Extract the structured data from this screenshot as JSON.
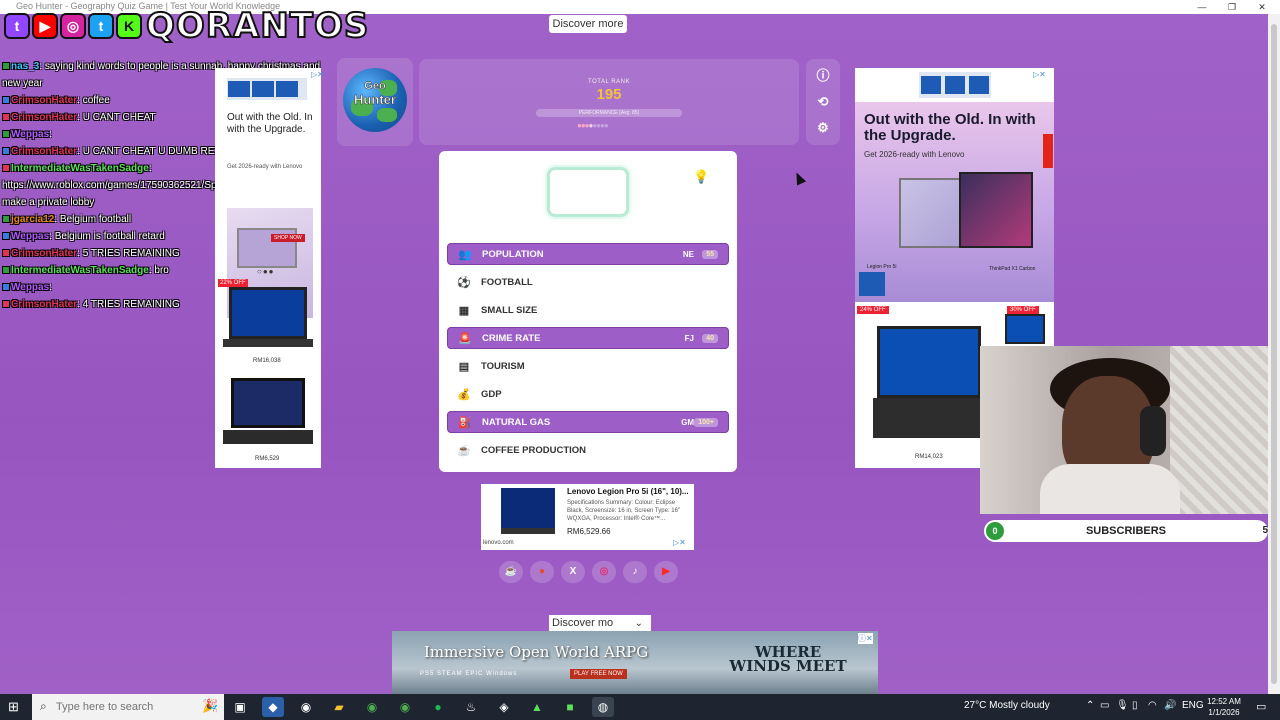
{
  "window": {
    "title": "Geo Hunter - Geography Quiz Game | Test Your World Knowledge",
    "minimize": "—",
    "restore": "❐",
    "close": "✕"
  },
  "overlay": {
    "brand_name": "QORANTOS",
    "social_icons": [
      "twitch-icon",
      "youtube-icon",
      "instagram-icon",
      "twitter-icon",
      "kick-icon"
    ]
  },
  "discover_top": "Discover more",
  "chat": [
    {
      "user": "nas_3",
      "user_color": "#3fc3ff",
      "text": ": saying kind words to people is a sunnah. happy christmas and new year"
    },
    {
      "user": "CrimsonHater",
      "user_color": "#e0335a",
      "text": ": coffee"
    },
    {
      "user": "CrimsonHater",
      "user_color": "#e0335a",
      "text": ": U CANT CHEAT"
    },
    {
      "user": "Weppas",
      "user_color": "#b35bff",
      "text": ":"
    },
    {
      "user": "CrimsonHater",
      "user_color": "#e0335a",
      "text": ": U CANT CHEAT U DUMB RETARD"
    },
    {
      "user": "IntermediateWasTakenSadge",
      "user_color": "#5ae05a",
      "text": ": https://www.roblox.com/games/17590362521/Spelling-Bee @qorantos make a private lobby"
    },
    {
      "user": "jgarcia12",
      "user_color": "#e38a1a",
      "text": ": Belgium football"
    },
    {
      "user": "Weppas",
      "user_color": "#b35bff",
      "text": ": Belgium is football retard"
    },
    {
      "user": "CrimsonHater",
      "user_color": "#e0335a",
      "text": ": 5 TRIES REMAINING"
    },
    {
      "user": "IntermediateWasTakenSadge",
      "user_color": "#5ae05a",
      "text": ": bro"
    },
    {
      "user": "Weppas",
      "user_color": "#b35bff",
      "text": ":"
    },
    {
      "user": "CrimsonHater",
      "user_color": "#e0335a",
      "text": ": 4 TRIES REMAINING"
    }
  ],
  "ad_left": {
    "title": "Out with the Old. In with the Upgrade.",
    "sub": "Get 2026-ready with Lenovo",
    "shop": "SHOP NOW",
    "discount": "22% OFF",
    "price1": "RM16,038",
    "price2": "RM6,529"
  },
  "logo": {
    "line1": "Geo",
    "line2": "Hunter"
  },
  "rank": {
    "label": "TOTAL RANK",
    "value": "195",
    "performance": "PERFORMANCE (Avg: 85)"
  },
  "side_buttons": [
    "info-icon",
    "refresh-icon",
    "settings-icon"
  ],
  "game": {
    "hint_icon": "lightbulb-icon",
    "categories": [
      {
        "label": "POPULATION",
        "icon": "👥",
        "state": "answered",
        "code": "NE",
        "score": "55"
      },
      {
        "label": "FOOTBALL",
        "icon": "⚽",
        "state": "plain",
        "code": "",
        "score": ""
      },
      {
        "label": "SMALL SIZE",
        "icon": "▦",
        "state": "plain",
        "code": "",
        "score": ""
      },
      {
        "label": "CRIME RATE",
        "icon": "🚨",
        "state": "answered",
        "code": "FJ",
        "score": "40"
      },
      {
        "label": "TOURISM",
        "icon": "▤",
        "state": "plain",
        "code": "",
        "score": ""
      },
      {
        "label": "GDP",
        "icon": "💰",
        "state": "plain",
        "code": "",
        "score": ""
      },
      {
        "label": "NATURAL GAS",
        "icon": "⛽",
        "state": "answered",
        "code": "GM",
        "score": "100+"
      },
      {
        "label": "COFFEE PRODUCTION",
        "icon": "☕",
        "state": "plain",
        "code": "",
        "score": ""
      }
    ]
  },
  "product_ad": {
    "title": "Lenovo Legion Pro 5i (16\", 10)...",
    "desc": "Specifications Summary: Colour: Eclipse Black, Screensize: 16 in, Screen Type: 16\" WQXGA, Processor: Intel® Core™...",
    "price": "RM6,529.66",
    "domain": "lenovo.com"
  },
  "social_links": [
    {
      "name": "coffee-icon",
      "glyph": "☕"
    },
    {
      "name": "reddit-icon",
      "glyph": "●"
    },
    {
      "name": "x-icon",
      "glyph": "X"
    },
    {
      "name": "instagram-icon",
      "glyph": "◎"
    },
    {
      "name": "tiktok-icon",
      "glyph": "♪"
    },
    {
      "name": "youtube-icon",
      "glyph": "▶"
    }
  ],
  "ad_right": {
    "title": "Out with the Old. In with the Upgrade.",
    "sub": "Get 2026-ready with Lenovo",
    "cap1": "Legion Pro 5i",
    "cap2": "ThinkPad X1 Carbon",
    "discount1": "24% OFF",
    "discount2": "30% OFF",
    "price": "RM14,023"
  },
  "subscribers": {
    "current": "0",
    "label": "SUBSCRIBERS",
    "goal": "5"
  },
  "discover_bottom": "Discover mo",
  "banner": {
    "title": "Immersive Open World ARPG",
    "brand": "WHERE WINDS MEET",
    "platforms": "PS5  STEAM  EPIC  Windows",
    "cta": "PLAY FREE NOW"
  },
  "taskbar": {
    "search_placeholder": "Type here to search",
    "weather": "27°C  Mostly cloudy",
    "lang": "ENG",
    "time": "12:52 AM",
    "date": "1/1/2026"
  }
}
